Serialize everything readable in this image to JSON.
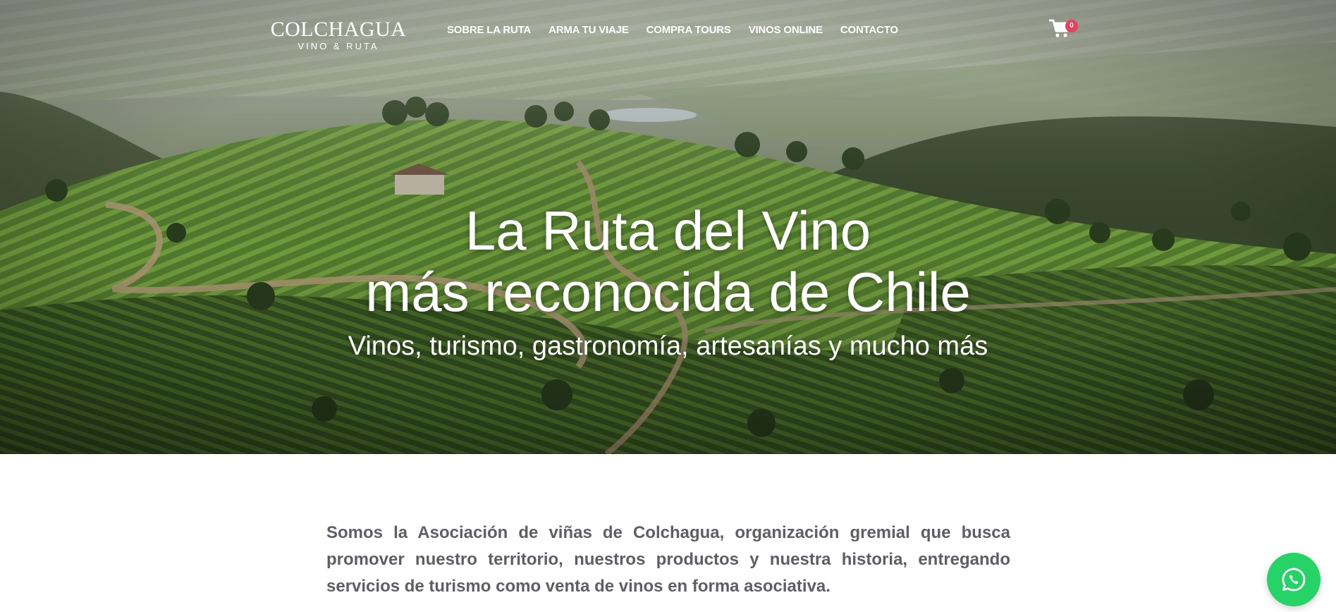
{
  "brand": {
    "name": "COLCHAGUA",
    "tagline": "VINO & RUTA"
  },
  "nav": {
    "items": [
      {
        "label": "SOBRE LA RUTA"
      },
      {
        "label": "ARMA TU VIAJE"
      },
      {
        "label": "COMPRA TOURS"
      },
      {
        "label": "VINOS ONLINE"
      },
      {
        "label": "CONTACTO"
      }
    ]
  },
  "cart": {
    "icon": "shopping-cart-icon",
    "count": "0",
    "badge_color": "#e8415f"
  },
  "hero": {
    "title_line1": "La Ruta del Vino",
    "title_line2": "más reconocida de Chile",
    "subtitle": "Vinos, turismo, gastronomía, artesanías y mucho más"
  },
  "intro": {
    "text": "Somos la Asociación de viñas de Colchagua, organización gremial que busca promover nuestro territorio, nuestros productos y nuestra historia, entregando servicios de turismo como venta de vinos en forma asociativa."
  },
  "whatsapp": {
    "icon": "whatsapp-icon",
    "color": "#25d366"
  }
}
